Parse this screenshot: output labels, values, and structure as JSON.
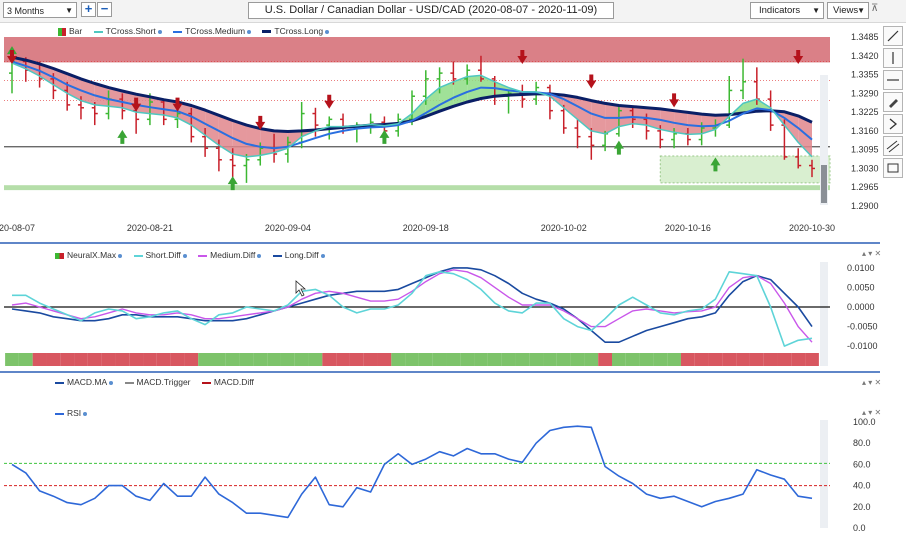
{
  "toolbar": {
    "range_select": "3 Months",
    "zoom_in_label": "+",
    "zoom_out_label": "−",
    "title": "U.S. Dollar / Canadian Dollar - USD/CAD (2020-08-07 - 2020-11-09)",
    "indicators_label": "Indicators",
    "views_label": "Views"
  },
  "colors": {
    "up_arrow": "#3aa535",
    "down_arrow": "#b5121b",
    "bar_green": "#3cb832",
    "bar_red": "#c8202a",
    "tcross_short": "#4fc7c0",
    "tcross_medium": "#2a6fe0",
    "tcross_long": "#0a1f66",
    "short_diff": "#5ed4d8",
    "medium_diff": "#c957ea",
    "long_diff": "#1a4aa0",
    "rsi": "#2e68d8",
    "ob_line": "#3ec43e",
    "os_line": "#d62020",
    "resistance_zone": "#d46a72",
    "support_zone": "#a8d89a"
  },
  "chart_data": [
    {
      "type": "line",
      "title": "",
      "legend": [
        "Bar",
        "TCross.Short",
        "TCross.Medium",
        "TCross.Long"
      ],
      "x_tick_labels": [
        "2020-08-07",
        "2020-08-21",
        "2020-09-04",
        "2020-09-18",
        "2020-10-02",
        "2020-10-16",
        "2020-10-30"
      ],
      "y_tick_labels": [
        "1.3485",
        "1.3420",
        "1.3355",
        "1.3290",
        "1.3225",
        "1.3160",
        "1.3095",
        "1.3030",
        "1.2965",
        "1.2900"
      ],
      "ylim": [
        1.29,
        1.3485
      ],
      "reference_line": 1.3105,
      "resistance_zone": [
        1.3397,
        1.3485
      ],
      "support_zone": [
        1.2955,
        1.2972
      ],
      "support_box": {
        "from_index": 47,
        "y": [
          1.298,
          1.3073
        ]
      },
      "x_count": 59,
      "ohlc": [
        [
          1.336,
          1.342,
          1.329,
          1.34
        ],
        [
          1.34,
          1.3415,
          1.333,
          1.337
        ],
        [
          1.337,
          1.34,
          1.331,
          1.334
        ],
        [
          1.334,
          1.336,
          1.327,
          1.33
        ],
        [
          1.33,
          1.333,
          1.323,
          1.325
        ],
        [
          1.325,
          1.328,
          1.32,
          1.324
        ],
        [
          1.324,
          1.326,
          1.318,
          1.322
        ],
        [
          1.322,
          1.33,
          1.32,
          1.327
        ],
        [
          1.327,
          1.329,
          1.32,
          1.323
        ],
        [
          1.323,
          1.326,
          1.315,
          1.32
        ],
        [
          1.32,
          1.329,
          1.318,
          1.326
        ],
        [
          1.326,
          1.327,
          1.318,
          1.32
        ],
        [
          1.32,
          1.325,
          1.317,
          1.322
        ],
        [
          1.322,
          1.324,
          1.312,
          1.314
        ],
        [
          1.314,
          1.317,
          1.307,
          1.31
        ],
        [
          1.31,
          1.313,
          1.302,
          1.306
        ],
        [
          1.306,
          1.31,
          1.3,
          1.304
        ],
        [
          1.304,
          1.308,
          1.298,
          1.306
        ],
        [
          1.306,
          1.312,
          1.304,
          1.31
        ],
        [
          1.31,
          1.315,
          1.305,
          1.308
        ],
        [
          1.308,
          1.314,
          1.305,
          1.312
        ],
        [
          1.312,
          1.326,
          1.31,
          1.322
        ],
        [
          1.322,
          1.324,
          1.314,
          1.318
        ],
        [
          1.318,
          1.321,
          1.313,
          1.32
        ],
        [
          1.32,
          1.322,
          1.315,
          1.317
        ],
        [
          1.317,
          1.319,
          1.312,
          1.318
        ],
        [
          1.318,
          1.322,
          1.315,
          1.319
        ],
        [
          1.319,
          1.321,
          1.313,
          1.316
        ],
        [
          1.316,
          1.322,
          1.314,
          1.32
        ],
        [
          1.32,
          1.33,
          1.318,
          1.328
        ],
        [
          1.328,
          1.337,
          1.325,
          1.334
        ],
        [
          1.334,
          1.338,
          1.329,
          1.336
        ],
        [
          1.336,
          1.34,
          1.332,
          1.334
        ],
        [
          1.334,
          1.339,
          1.332,
          1.337
        ],
        [
          1.337,
          1.342,
          1.333,
          1.334
        ],
        [
          1.334,
          1.335,
          1.325,
          1.328
        ],
        [
          1.328,
          1.33,
          1.322,
          1.329
        ],
        [
          1.329,
          1.332,
          1.324,
          1.327
        ],
        [
          1.327,
          1.333,
          1.325,
          1.331
        ],
        [
          1.331,
          1.332,
          1.32,
          1.323
        ],
        [
          1.323,
          1.325,
          1.315,
          1.317
        ],
        [
          1.317,
          1.32,
          1.31,
          1.314
        ],
        [
          1.314,
          1.317,
          1.306,
          1.311
        ],
        [
          1.311,
          1.316,
          1.309,
          1.315
        ],
        [
          1.315,
          1.325,
          1.314,
          1.323
        ],
        [
          1.323,
          1.324,
          1.317,
          1.32
        ],
        [
          1.32,
          1.322,
          1.313,
          1.316
        ],
        [
          1.316,
          1.318,
          1.31,
          1.313
        ],
        [
          1.313,
          1.317,
          1.31,
          1.315
        ],
        [
          1.315,
          1.317,
          1.311,
          1.313
        ],
        [
          1.313,
          1.319,
          1.311,
          1.317
        ],
        [
          1.317,
          1.32,
          1.314,
          1.318
        ],
        [
          1.318,
          1.335,
          1.317,
          1.33
        ],
        [
          1.33,
          1.341,
          1.327,
          1.333
        ],
        [
          1.333,
          1.338,
          1.325,
          1.327
        ],
        [
          1.327,
          1.33,
          1.316,
          1.318
        ],
        [
          1.318,
          1.32,
          1.306,
          1.307
        ],
        [
          1.307,
          1.31,
          1.303,
          1.304
        ],
        [
          1.304,
          1.306,
          1.3,
          1.303
        ]
      ],
      "series": [
        {
          "name": "TCross.Short",
          "values": [
            1.3395,
            1.3375,
            1.335,
            1.332,
            1.329,
            1.3265,
            1.325,
            1.3245,
            1.324,
            1.3225,
            1.322,
            1.3215,
            1.3205,
            1.318,
            1.3145,
            1.311,
            1.308,
            1.307,
            1.3075,
            1.3085,
            1.31,
            1.314,
            1.316,
            1.3175,
            1.3175,
            1.3178,
            1.3182,
            1.3178,
            1.3185,
            1.322,
            1.327,
            1.331,
            1.333,
            1.3348,
            1.3352,
            1.333,
            1.331,
            1.3295,
            1.3295,
            1.328,
            1.324,
            1.32,
            1.316,
            1.315,
            1.3175,
            1.3185,
            1.318,
            1.3165,
            1.3155,
            1.3148,
            1.315,
            1.3165,
            1.321,
            1.3255,
            1.327,
            1.324,
            1.318,
            1.312,
            1.307
          ]
        },
        {
          "name": "TCross.Medium",
          "values": [
            1.34,
            1.3385,
            1.3368,
            1.3345,
            1.332,
            1.33,
            1.3283,
            1.327,
            1.326,
            1.325,
            1.3242,
            1.3235,
            1.3228,
            1.321,
            1.3185,
            1.316,
            1.3135,
            1.3115,
            1.3105,
            1.31,
            1.3105,
            1.312,
            1.3135,
            1.315,
            1.316,
            1.3168,
            1.3172,
            1.3174,
            1.318,
            1.3195,
            1.3222,
            1.325,
            1.3275,
            1.3295,
            1.331,
            1.3308,
            1.33,
            1.3295,
            1.3294,
            1.3288,
            1.327,
            1.3245,
            1.322,
            1.3205,
            1.3205,
            1.3208,
            1.3205,
            1.3198,
            1.3188,
            1.318,
            1.3176,
            1.3178,
            1.3195,
            1.322,
            1.3238,
            1.3232,
            1.3205,
            1.317,
            1.313
          ]
        },
        {
          "name": "TCross.Long",
          "values": [
            1.3415,
            1.3405,
            1.3392,
            1.3376,
            1.3358,
            1.334,
            1.3324,
            1.331,
            1.3298,
            1.3287,
            1.3278,
            1.3268,
            1.326,
            1.3248,
            1.3232,
            1.3214,
            1.3196,
            1.318,
            1.3168,
            1.316,
            1.3158,
            1.316,
            1.3163,
            1.3168,
            1.3172,
            1.3176,
            1.318,
            1.3182,
            1.3186,
            1.3195,
            1.321,
            1.3228,
            1.3245,
            1.326,
            1.3272,
            1.328,
            1.3284,
            1.3286,
            1.3288,
            1.3288,
            1.3284,
            1.3276,
            1.3265,
            1.3255,
            1.3248,
            1.3244,
            1.324,
            1.3236,
            1.323,
            1.3224,
            1.3218,
            1.3214,
            1.3216,
            1.3222,
            1.3228,
            1.323,
            1.3226,
            1.3212,
            1.319
          ]
        }
      ],
      "up_arrows": [
        {
          "index": 0,
          "price": 1.3405
        },
        {
          "index": 8,
          "price": 1.3115
        },
        {
          "index": 16,
          "price": 1.2955
        },
        {
          "index": 27,
          "price": 1.3115
        },
        {
          "index": 44,
          "price": 1.3078
        },
        {
          "index": 51,
          "price": 1.302
        }
      ],
      "down_arrows": [
        {
          "index": 0,
          "price": 1.344
        },
        {
          "index": 9,
          "price": 1.3275
        },
        {
          "index": 12,
          "price": 1.3275
        },
        {
          "index": 18,
          "price": 1.3212
        },
        {
          "index": 23,
          "price": 1.3285
        },
        {
          "index": 37,
          "price": 1.344
        },
        {
          "index": 42,
          "price": 1.3355
        },
        {
          "index": 48,
          "price": 1.329
        },
        {
          "index": 57,
          "price": 1.344
        }
      ]
    },
    {
      "type": "line",
      "legend": [
        "NeuralX.Max",
        "Short.Diff",
        "Medium.Diff",
        "Long.Diff"
      ],
      "y_tick_labels": [
        "0.0100",
        "0.0050",
        "0.0000",
        "-0.0050",
        "-0.0100"
      ],
      "ylim": [
        -0.0115,
        0.0115
      ],
      "zero_line": 0.0,
      "series": [
        {
          "name": "Short.Diff",
          "values": [
            0.003,
            0.003,
            0.001,
            -0.0005,
            -0.002,
            -0.0035,
            -0.0015,
            -0.0005,
            -0.001,
            -0.003,
            -0.0025,
            -0.0015,
            -0.001,
            -0.003,
            -0.0045,
            -0.002,
            -0.0015,
            0.0,
            -0.0005,
            -0.001,
            0.0005,
            0.004,
            0.0045,
            0.003,
            0.0,
            -0.0015,
            -0.0005,
            -0.0005,
            0.0005,
            0.0035,
            0.008,
            0.009,
            0.0085,
            0.007,
            0.0045,
            0.001,
            -0.001,
            -0.0015,
            0.001,
            0.001,
            -0.003,
            -0.005,
            -0.006,
            -0.003,
            0.0005,
            0.0025,
            0.0005,
            -0.0015,
            -0.002,
            -0.001,
            -0.0005,
            0.002,
            0.009,
            0.0085,
            0.008,
            0.0,
            -0.01,
            -0.0085,
            -0.008
          ]
        },
        {
          "name": "Medium.Diff",
          "values": [
            0.0005,
            0.001,
            0.0,
            -0.001,
            -0.002,
            -0.003,
            -0.0025,
            -0.0015,
            -0.0005,
            -0.0015,
            -0.002,
            -0.002,
            -0.0015,
            -0.002,
            -0.003,
            -0.003,
            -0.0025,
            -0.002,
            -0.0015,
            -0.001,
            0.0,
            0.002,
            0.0035,
            0.004,
            0.0035,
            0.0025,
            0.0015,
            0.0015,
            0.002,
            0.004,
            0.0065,
            0.0085,
            0.0095,
            0.009,
            0.0075,
            0.005,
            0.0025,
            0.0005,
            0.0005,
            0.0005,
            -0.001,
            -0.003,
            -0.005,
            -0.005,
            -0.003,
            -0.001,
            -0.0005,
            -0.001,
            -0.0015,
            -0.0012,
            -0.001,
            0.0,
            0.005,
            0.0075,
            0.008,
            0.006,
            0.001,
            -0.005,
            -0.009
          ]
        },
        {
          "name": "Long.Diff",
          "values": [
            -0.0005,
            -0.001,
            -0.0015,
            -0.0025,
            -0.003,
            -0.0035,
            -0.0035,
            -0.003,
            -0.002,
            -0.002,
            -0.0025,
            -0.0025,
            -0.0025,
            -0.003,
            -0.0035,
            -0.0035,
            -0.0035,
            -0.003,
            -0.002,
            -0.001,
            0.0,
            0.001,
            0.002,
            0.003,
            0.0035,
            0.004,
            0.004,
            0.004,
            0.0045,
            0.006,
            0.0075,
            0.009,
            0.01,
            0.01,
            0.0095,
            0.008,
            0.006,
            0.0035,
            0.002,
            0.001,
            -0.0005,
            -0.003,
            -0.006,
            -0.009,
            -0.009,
            -0.0075,
            -0.006,
            -0.005,
            -0.004,
            -0.003,
            -0.0025,
            -0.0015,
            0.003,
            0.0065,
            0.008,
            0.007,
            0.0035,
            0.0,
            -0.005
          ]
        }
      ],
      "neuralx_max_colors": "GGRRRRRRRRRRRRGGGGGGGGGRRRRRGGGGGGGGGGGGGGGRGGGGGRRRRRRRRRR"
    },
    {
      "type": "line",
      "legend": [
        "MACD.MA",
        "MACD.Trigger",
        "MACD.Diff",
        "RSI"
      ],
      "y_tick_labels": [
        "100.0",
        "80.0",
        "60.0",
        "40.0",
        "20.0",
        "0.0"
      ],
      "ylim": [
        0,
        100
      ],
      "overbought": 61,
      "oversold": 40,
      "series": [
        {
          "name": "RSI",
          "values": [
            60,
            52,
            35,
            30,
            24,
            22,
            28,
            40,
            40,
            30,
            26,
            42,
            30,
            30,
            48,
            32,
            24,
            14,
            14,
            12,
            10,
            32,
            48,
            22,
            20,
            38,
            34,
            60,
            70,
            60,
            65,
            72,
            68,
            75,
            70,
            70,
            65,
            62,
            80,
            92,
            95,
            96,
            95,
            58,
            49,
            42,
            32,
            28,
            30,
            25,
            20,
            25,
            28,
            32,
            55,
            50,
            46,
            30,
            28
          ]
        }
      ]
    }
  ]
}
